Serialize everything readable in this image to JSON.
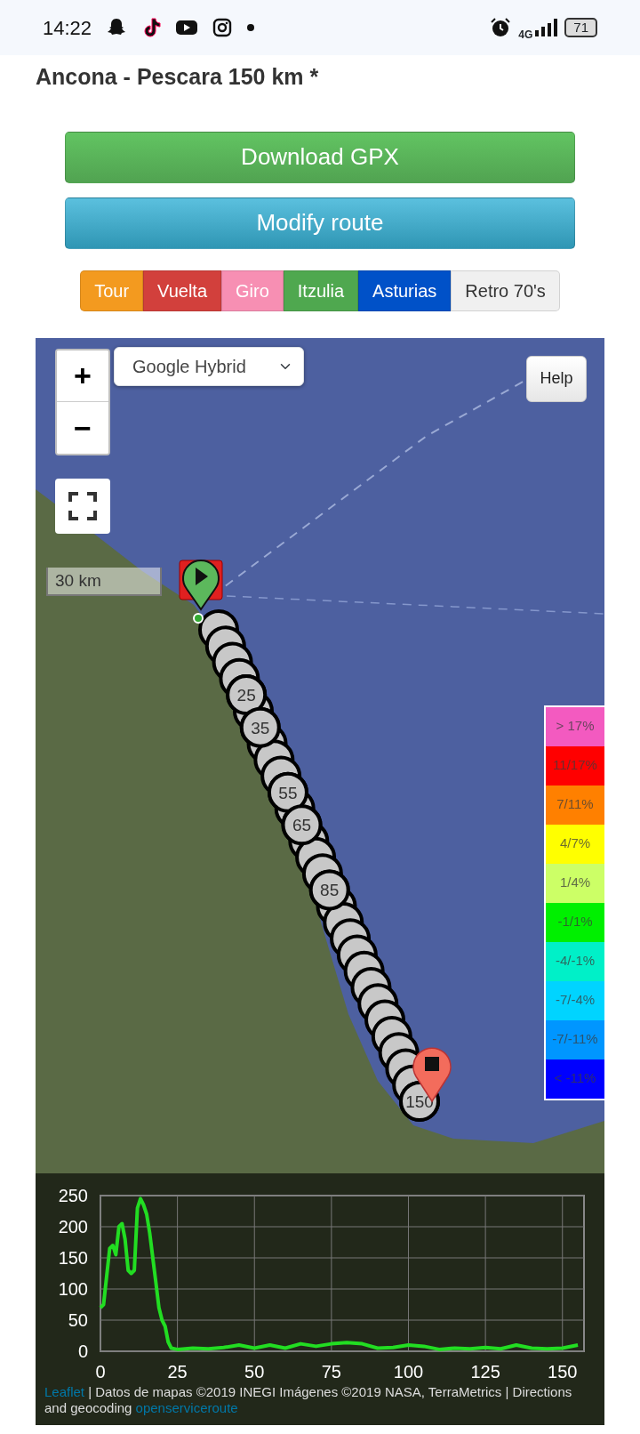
{
  "status_bar": {
    "time": "14:22",
    "network": "4G",
    "battery": "71"
  },
  "title": "Ancona - Pescara 150 km *",
  "actions": [
    {
      "label": "Download GPX",
      "kind": "success"
    },
    {
      "label": "Modify route",
      "kind": "info"
    }
  ],
  "styles": [
    {
      "label": "Tour",
      "color": "#f39a1f"
    },
    {
      "label": "Vuelta",
      "color": "#d2403c"
    },
    {
      "label": "Giro",
      "color": "#f78fb3"
    },
    {
      "label": "Itzulia",
      "color": "#4fa84f"
    },
    {
      "label": "Asturias",
      "color": "#0051c8"
    },
    {
      "label": "Retro 70's",
      "color": "#f0f0f0"
    }
  ],
  "map": {
    "layer_select": {
      "value": "Google Hybrid"
    },
    "zoom_controls": [
      "+",
      "−"
    ],
    "help_button": "Help",
    "scale": "30 km",
    "legend": [
      {
        "label": "> 17%",
        "color": "#f35ac0"
      },
      {
        "label": "11/17%",
        "color": "#ff0000"
      },
      {
        "label": "7/11%",
        "color": "#ff8000"
      },
      {
        "label": "4/7%",
        "color": "#ffff00"
      },
      {
        "label": "1/4%",
        "color": "#ccff66"
      },
      {
        "label": "-1/1%",
        "color": "#00f000"
      },
      {
        "label": "-4/-1%",
        "color": "#00f0c8"
      },
      {
        "label": "-7/-4%",
        "color": "#00d4ff"
      },
      {
        "label": "-7/-11%",
        "color": "#0096ff"
      },
      {
        "label": "< -11%",
        "color": "#0000ff"
      }
    ],
    "km_markers": [
      {
        "label": "25"
      },
      {
        "label": "35"
      },
      {
        "label": "55"
      },
      {
        "label": "65"
      },
      {
        "label": "85"
      },
      {
        "label": "150"
      }
    ],
    "chart_data": {
      "type": "line",
      "xlim": [
        0,
        157
      ],
      "ylim": [
        0,
        250
      ],
      "xticks": [
        0,
        25,
        50,
        75,
        100,
        125,
        150
      ],
      "yticks": [
        0,
        50,
        100,
        150,
        200,
        250
      ],
      "grid": true,
      "x": [
        0,
        1,
        3,
        4,
        5,
        6,
        7,
        8,
        9,
        10,
        11,
        12,
        13,
        14,
        15,
        16,
        17,
        18,
        19,
        20,
        21,
        22,
        23,
        25,
        30,
        35,
        40,
        45,
        50,
        55,
        60,
        65,
        70,
        75,
        80,
        85,
        90,
        95,
        100,
        105,
        110,
        115,
        120,
        125,
        130,
        135,
        140,
        145,
        150,
        155
      ],
      "series": [
        {
          "color": "#22dd22",
          "values": [
            70,
            75,
            165,
            170,
            155,
            200,
            205,
            180,
            130,
            125,
            130,
            230,
            245,
            235,
            220,
            190,
            150,
            110,
            70,
            50,
            40,
            15,
            5,
            3,
            5,
            4,
            6,
            10,
            5,
            10,
            5,
            12,
            8,
            12,
            14,
            12,
            5,
            6,
            10,
            8,
            3,
            5,
            4,
            6,
            4,
            10,
            5,
            4,
            5,
            10
          ]
        }
      ]
    },
    "attribution": [
      {
        "kind": "link",
        "text": "Leaflet"
      },
      {
        "kind": "text",
        "text": " | Datos de mapas ©2019 INEGI Imágenes ©2019 NASA, TerraMetrics | Directions and geocoding "
      },
      {
        "kind": "link",
        "text": "openserviceroute"
      }
    ]
  }
}
